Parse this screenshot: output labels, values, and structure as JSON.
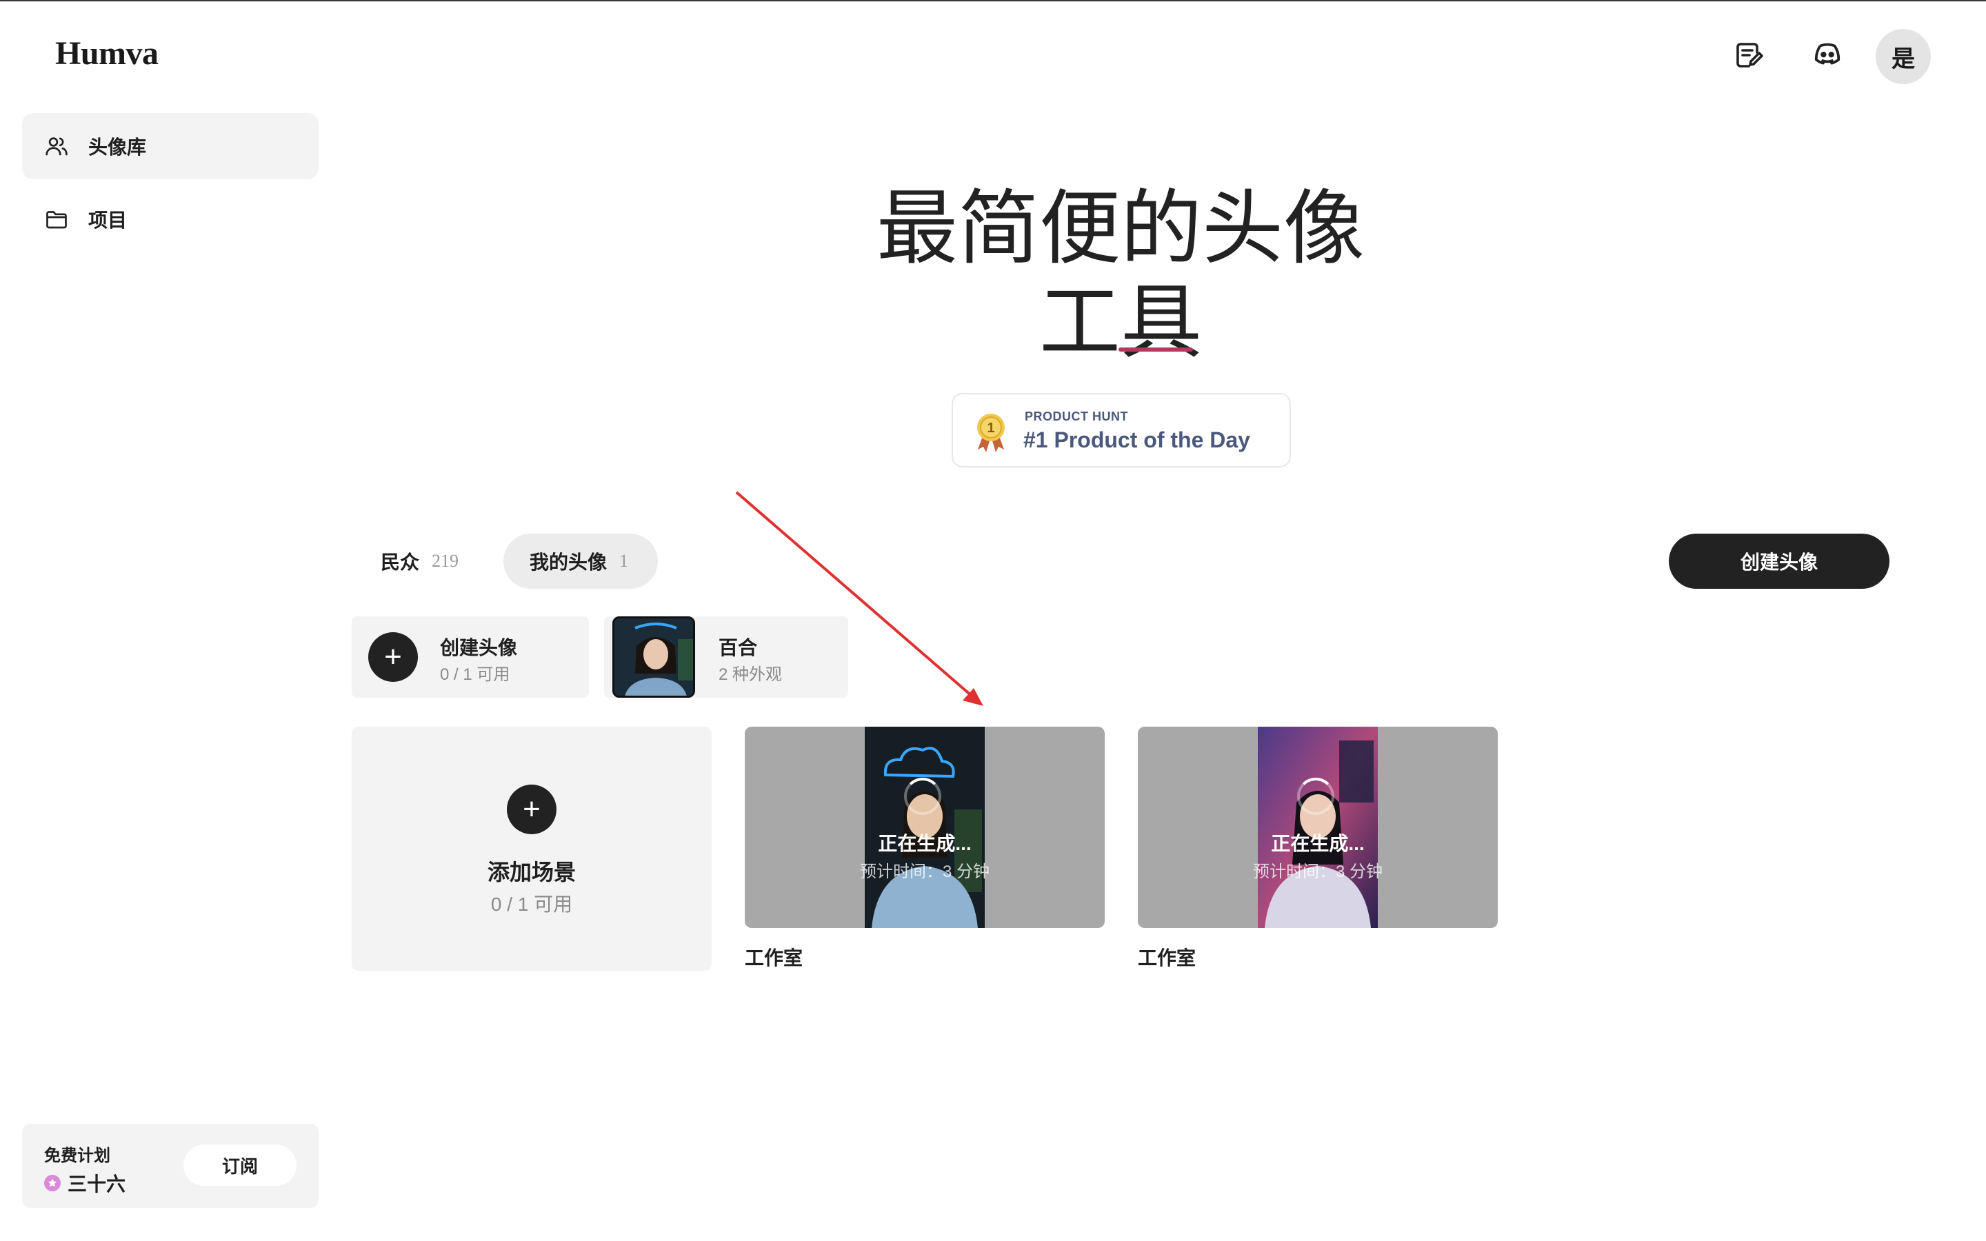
{
  "app": {
    "logo": "Humva"
  },
  "sidebar": {
    "items": [
      {
        "label": "头像库",
        "icon": "users-icon",
        "active": true
      },
      {
        "label": "项目",
        "icon": "folder-icon",
        "active": false
      }
    ],
    "plan": {
      "title": "免费计划",
      "credits": "三十六",
      "subscribe_label": "订阅"
    }
  },
  "header": {
    "icons": [
      "feedback-edit-icon",
      "discord-icon"
    ],
    "avatar_initial": "是"
  },
  "hero": {
    "line1": "最简便的头像",
    "line2_a": "工",
    "line2_b": "具"
  },
  "product_hunt": {
    "top": "PRODUCT HUNT",
    "main": "#1 Product of the Day",
    "medal_number": "1"
  },
  "tabs": [
    {
      "label": "民众",
      "count": "219",
      "active": false
    },
    {
      "label": "我的头像",
      "count": "1",
      "active": true
    }
  ],
  "create_avatar_button": "创建头像",
  "avatar_cards": {
    "create": {
      "title": "创建头像",
      "subtitle": "0 / 1 可用"
    },
    "lily": {
      "title": "百合",
      "subtitle": "2 种外观"
    }
  },
  "scenes": {
    "add": {
      "title": "添加场景",
      "subtitle": "0 / 1 可用"
    },
    "items": [
      {
        "status": "正在生成...",
        "eta": "预计时间：3 分钟",
        "label": "工作室",
        "theme": "blue-neon-cloud"
      },
      {
        "status": "正在生成...",
        "eta": "预计时间：3 分钟",
        "label": "工作室",
        "theme": "pink-purple"
      }
    ]
  },
  "colors": {
    "accent_dark": "#222222",
    "product_hunt": "#4b587c",
    "hero_underline": "#b23a5a",
    "annotation_arrow": "#e03030"
  }
}
